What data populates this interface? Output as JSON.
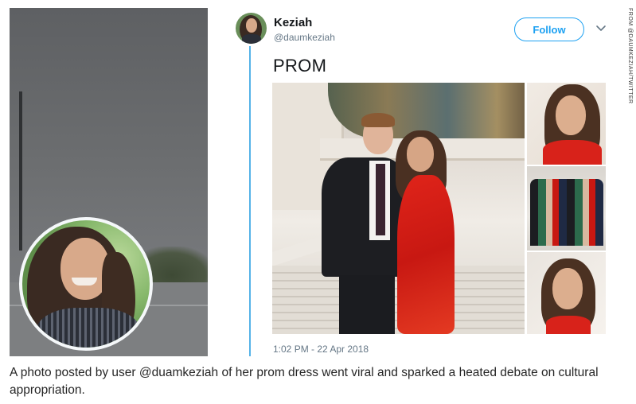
{
  "tweet": {
    "display_name": "Keziah",
    "handle": "@daumkeziah",
    "follow_label": "Follow",
    "text": "PROM",
    "timestamp": "1:02 PM - 22 Apr 2018",
    "photos": [
      "prom-photo-couple",
      "prom-photo-closeup-smile",
      "prom-photo-group",
      "prom-photo-portrait"
    ]
  },
  "credit": "FROM @DAUMKEZIAH/TWITTER",
  "caption": "A photo posted by user @duamkeziah of her prom dress went viral and sparked a heated debate on cultural appropriation.",
  "colors": {
    "accent": "#1da1f2",
    "thread_line": "#55b3e8",
    "dress_red": "#d8221a"
  },
  "icons": [
    "chevron-down-icon"
  ]
}
